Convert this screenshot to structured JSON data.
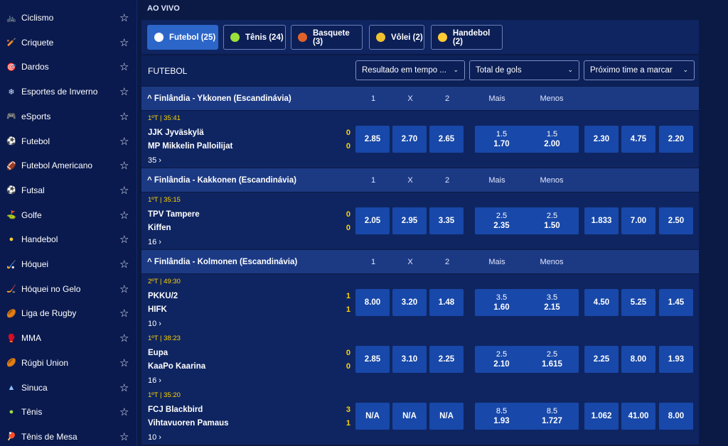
{
  "sidebar": [
    {
      "label": "Ciclismo",
      "icon": "bicycle-icon",
      "glyph": "🚲",
      "color": "#6ab0ff"
    },
    {
      "label": "Criquete",
      "icon": "cricket-bat-icon",
      "glyph": "🏏",
      "color": "#f0b040"
    },
    {
      "label": "Dardos",
      "icon": "darts-icon",
      "glyph": "🎯",
      "color": "#ff7a3a"
    },
    {
      "label": "Esportes de Inverno",
      "icon": "snowflake-icon",
      "glyph": "❄",
      "color": "#cfe6ff"
    },
    {
      "label": "eSports",
      "icon": "gamepad-icon",
      "glyph": "🎮",
      "color": "#9fb7ff"
    },
    {
      "label": "Futebol",
      "icon": "soccer-ball-icon",
      "glyph": "⚽",
      "color": "#ffffff"
    },
    {
      "label": "Futebol Americano",
      "icon": "american-football-icon",
      "glyph": "🏈",
      "color": "#e05a3a"
    },
    {
      "label": "Futsal",
      "icon": "futsal-ball-icon",
      "glyph": "⚽",
      "color": "#ffffff"
    },
    {
      "label": "Golfe",
      "icon": "golf-ball-icon",
      "glyph": "⛳",
      "color": "#ffffff"
    },
    {
      "label": "Handebol",
      "icon": "handball-icon",
      "glyph": "●",
      "color": "#ffcc33"
    },
    {
      "label": "Hóquei",
      "icon": "hockey-stick-icon",
      "glyph": "🏑",
      "color": "#cfd8ff"
    },
    {
      "label": "Hóquei no Gelo",
      "icon": "ice-hockey-icon",
      "glyph": "🏒",
      "color": "#cfd8ff"
    },
    {
      "label": "Liga de Rugby",
      "icon": "rugby-ball-icon",
      "glyph": "🏉",
      "color": "#6aa8ff"
    },
    {
      "label": "MMA",
      "icon": "mma-icon",
      "glyph": "🥊",
      "color": "#4aa0ff"
    },
    {
      "label": "Rúgbi Union",
      "icon": "rugby-union-icon",
      "glyph": "🏉",
      "color": "#c9a06a"
    },
    {
      "label": "Sinuca",
      "icon": "snooker-icon",
      "glyph": "▲",
      "color": "#8fc4ff"
    },
    {
      "label": "Tênis",
      "icon": "tennis-ball-icon",
      "glyph": "●",
      "color": "#9be03a"
    },
    {
      "label": "Tênis de Mesa",
      "icon": "table-tennis-icon",
      "glyph": "🏓",
      "color": "#4aa0ff"
    }
  ],
  "section_title": "AO VIVO",
  "tabs": [
    {
      "label": "Futebol (25)",
      "icon": "soccer-ball-icon",
      "color": "#ffffff",
      "active": true
    },
    {
      "label": "Tênis (24)",
      "icon": "tennis-ball-icon",
      "color": "#9be03a",
      "active": false
    },
    {
      "label": "Basquete (3)",
      "icon": "basketball-icon",
      "color": "#e0622a",
      "active": false
    },
    {
      "label": "Vôlei (2)",
      "icon": "volleyball-icon",
      "color": "#f0c030",
      "active": false
    },
    {
      "label": "Handebol (2)",
      "icon": "handball-icon",
      "color": "#ffcc33",
      "active": false
    }
  ],
  "filter_label": "FUTEBOL",
  "dropdowns": [
    "Resultado em tempo ...",
    "Total de gols",
    "Próximo time a marcar"
  ],
  "column_headers": [
    "1",
    "X",
    "2",
    "Mais",
    "Menos"
  ],
  "leagues": [
    {
      "name": "Finlândia - Ykkonen (Escandinávia)",
      "matches": [
        {
          "time": "1ºT | 35:41",
          "home": "JJK Jyväskylä",
          "away": "MP Mikkelin Palloilijat",
          "home_score": "0",
          "away_score": "0",
          "more": "35 ›",
          "odds": [
            "2.85",
            "2.70",
            "2.65"
          ],
          "over": {
            "line": "1.5",
            "price": "1.70"
          },
          "under": {
            "line": "1.5",
            "price": "2.00"
          },
          "next": [
            "2.30",
            "4.75",
            "2.20"
          ]
        }
      ]
    },
    {
      "name": "Finlândia - Kakkonen (Escandinávia)",
      "matches": [
        {
          "time": "1ºT | 35:15",
          "home": "TPV Tampere",
          "away": "Kiffen",
          "home_score": "0",
          "away_score": "0",
          "more": "16 ›",
          "odds": [
            "2.05",
            "2.95",
            "3.35"
          ],
          "over": {
            "line": "2.5",
            "price": "2.35"
          },
          "under": {
            "line": "2.5",
            "price": "1.50"
          },
          "next": [
            "1.833",
            "7.00",
            "2.50"
          ]
        }
      ]
    },
    {
      "name": "Finlândia - Kolmonen (Escandinávia)",
      "matches": [
        {
          "time": "2ºT | 49:30",
          "home": "PKKU/2",
          "away": "HIFK",
          "home_score": "1",
          "away_score": "1",
          "more": "10 ›",
          "odds": [
            "8.00",
            "3.20",
            "1.48"
          ],
          "over": {
            "line": "3.5",
            "price": "1.60"
          },
          "under": {
            "line": "3.5",
            "price": "2.15"
          },
          "next": [
            "4.50",
            "5.25",
            "1.45"
          ]
        },
        {
          "time": "1ºT | 38:23",
          "home": "Eupa",
          "away": "KaaPo Kaarina",
          "home_score": "0",
          "away_score": "0",
          "more": "16 ›",
          "odds": [
            "2.85",
            "3.10",
            "2.25"
          ],
          "over": {
            "line": "2.5",
            "price": "2.10"
          },
          "under": {
            "line": "2.5",
            "price": "1.615"
          },
          "next": [
            "2.25",
            "8.00",
            "1.93"
          ]
        },
        {
          "time": "1ºT | 35:20",
          "home": "FCJ Blackbird",
          "away": "Vihtavuoren Pamaus",
          "home_score": "3",
          "away_score": "1",
          "more": "10 ›",
          "odds": [
            "N/A",
            "N/A",
            "N/A"
          ],
          "over": {
            "line": "8.5",
            "price": "1.93"
          },
          "under": {
            "line": "8.5",
            "price": "1.727"
          },
          "next": [
            "1.062",
            "41.00",
            "8.00"
          ]
        }
      ]
    }
  ]
}
